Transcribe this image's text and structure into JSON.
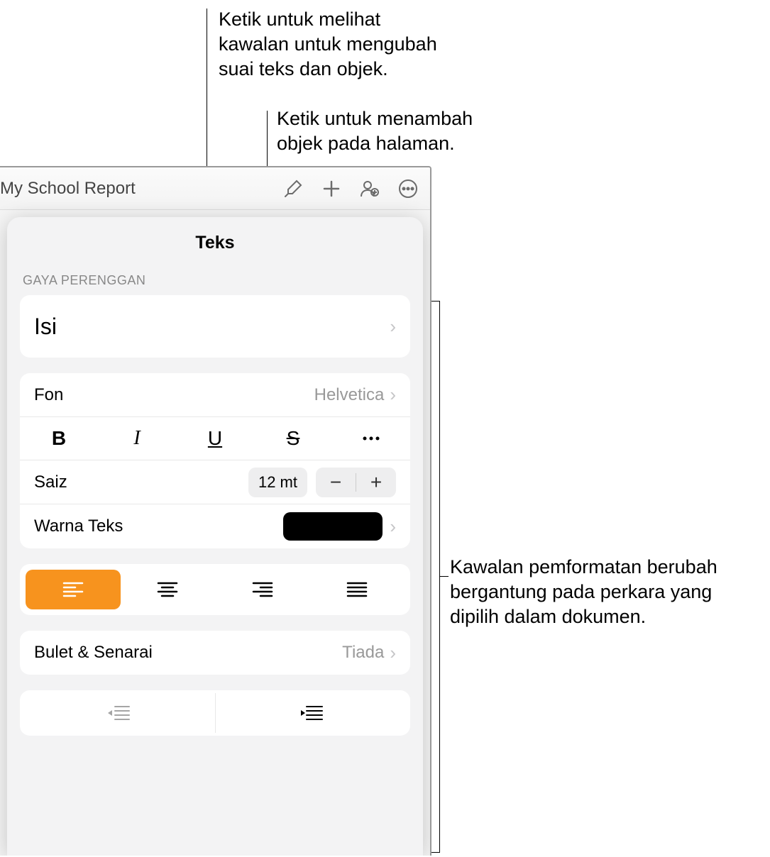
{
  "callouts": {
    "format": "Ketik untuk melihat kawalan untuk mengubah suai teks dan objek.",
    "insert": "Ketik untuk menambah objek pada halaman.",
    "panel": "Kawalan pemformatan berubah bergantung pada perkara yang dipilih dalam dokumen."
  },
  "toolbar": {
    "title": "My School Report"
  },
  "popover": {
    "title": "Teks",
    "section_style": "GAYA PERENGGAN",
    "paragraph_style_value": "Isi",
    "font_label": "Fon",
    "font_value": "Helvetica",
    "size_label": "Saiz",
    "size_value": "12 mt",
    "text_color_label": "Warna Teks",
    "bullets_label": "Bulet & Senarai",
    "bullets_value": "Tiada"
  }
}
